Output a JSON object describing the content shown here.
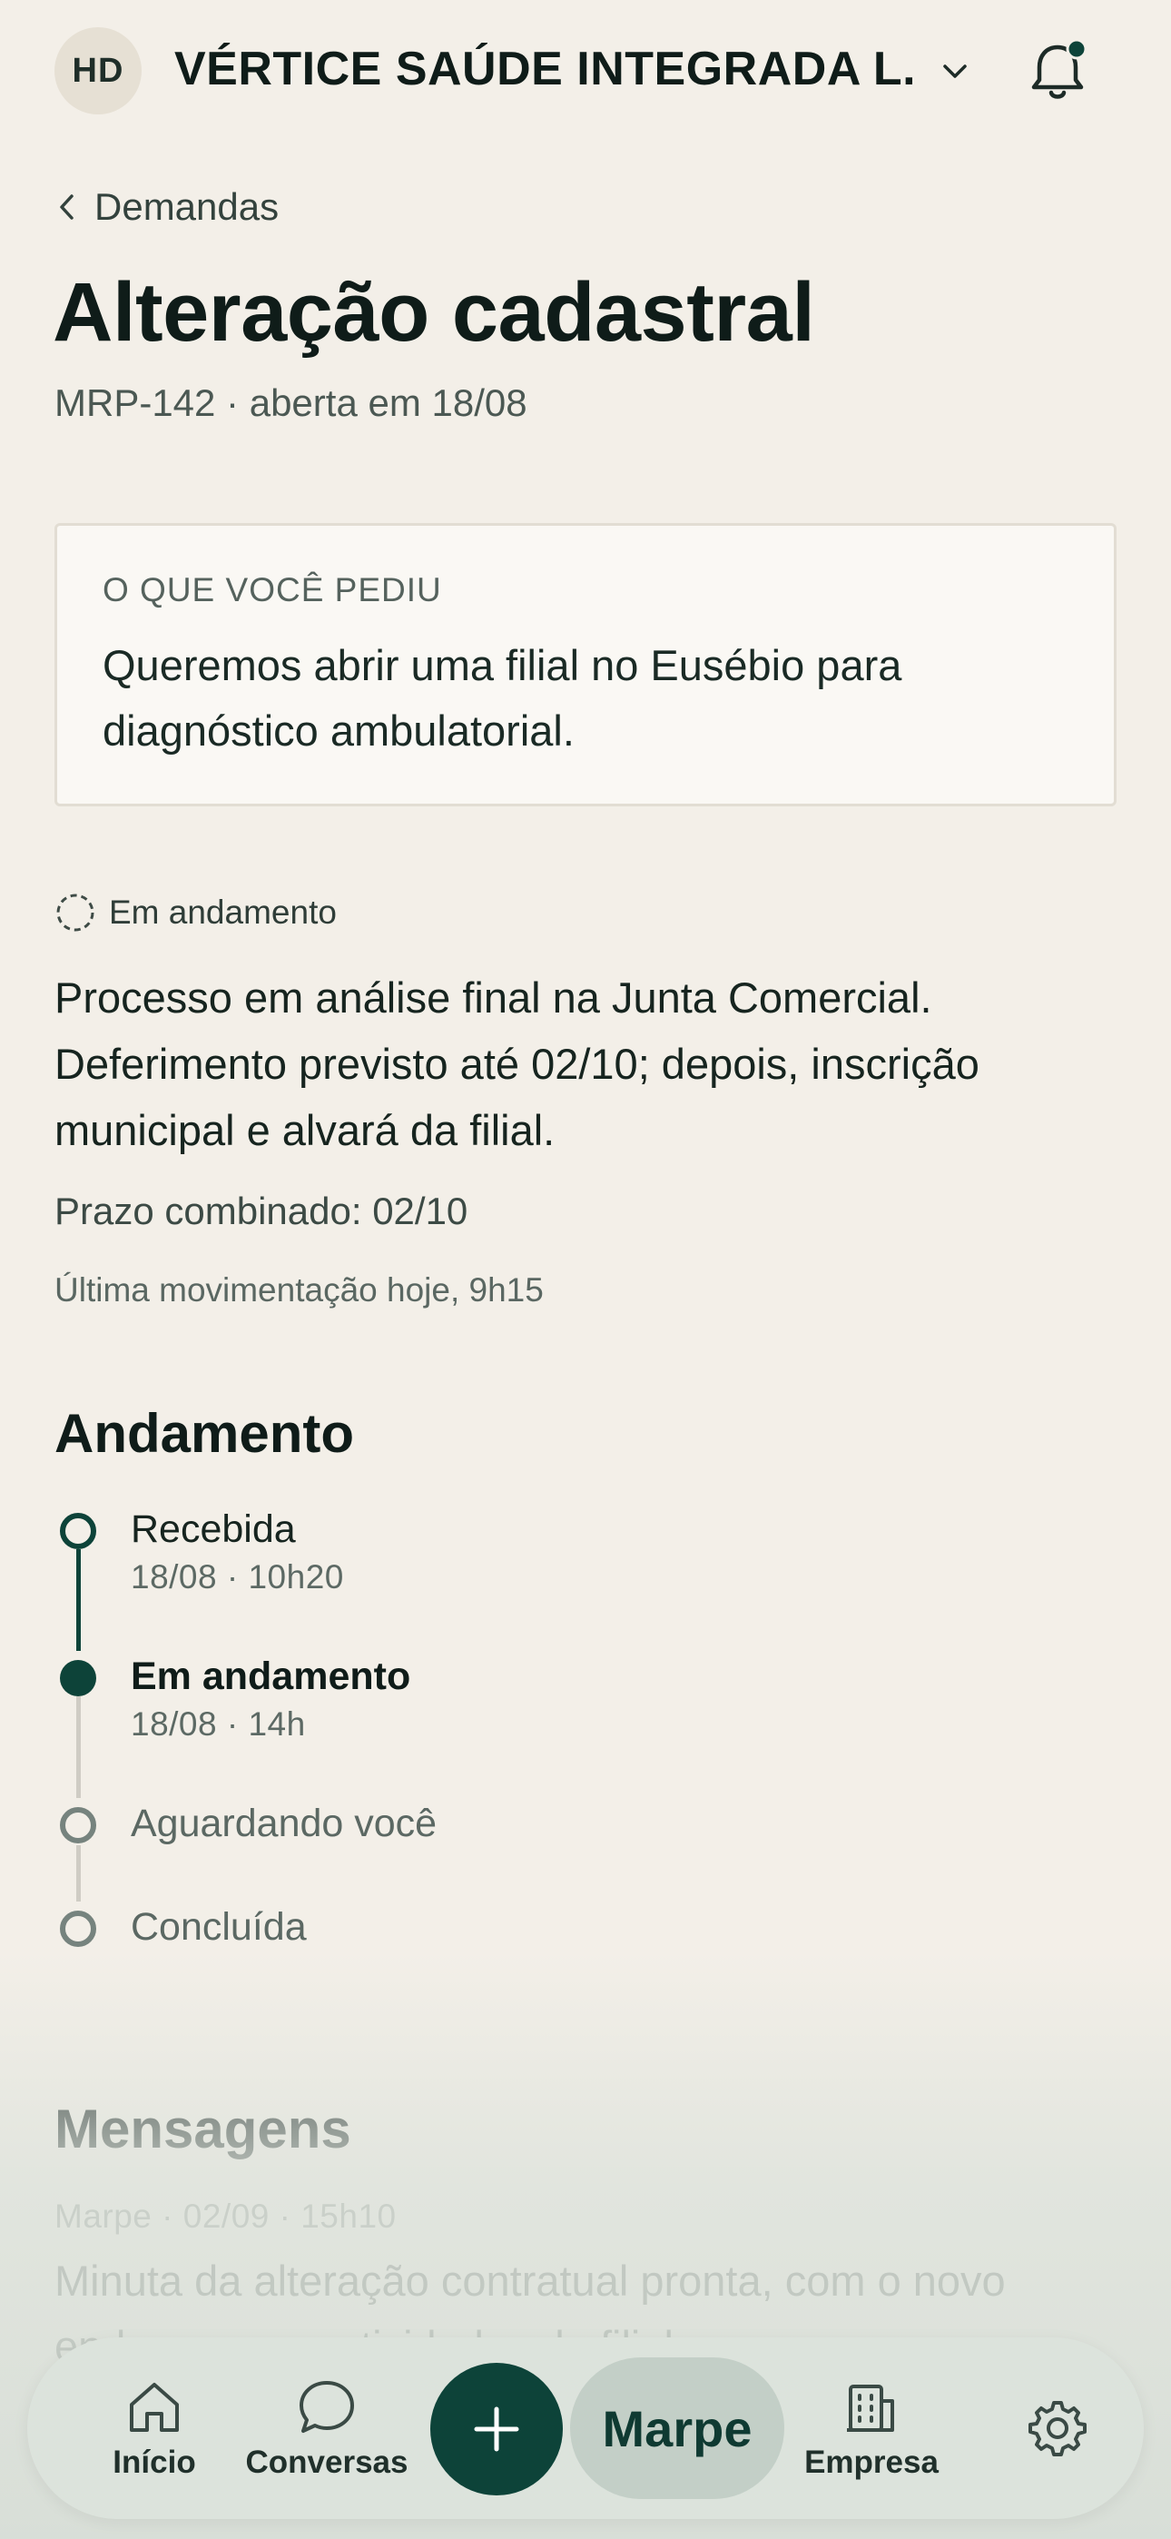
{
  "header": {
    "avatar_initials": "HD",
    "company_name": "VÉRTICE SAÚDE INTEGRADA L...",
    "switch_icon": "chevron-down-icon",
    "notification_icon": "bell-icon",
    "has_unread": true
  },
  "nav": {
    "back_label": "Demandas"
  },
  "demand": {
    "title": "Alteração cadastral",
    "subtitle": "MRP-142 · aberta em 18/08"
  },
  "request": {
    "kicker": "O QUE VOCÊ PEDIU",
    "text": "Queremos abrir uma filial no Eusébio para diagnóstico ambulatorial."
  },
  "status": {
    "label": "Em andamento",
    "description": "Processo em análise final na Junta Comercial. Deferimento previsto até 02/10; depois, inscrição municipal e alvará da filial.",
    "deadline": "Prazo combinado: 02/10",
    "last_update": "Última movimentação hoje, 9h15"
  },
  "timeline": {
    "title": "Andamento",
    "steps": [
      {
        "label": "Recebida",
        "time": "18/08 · 10h20",
        "state": "done"
      },
      {
        "label": "Em andamento",
        "time": "18/08 · 14h",
        "state": "current"
      },
      {
        "label": "Aguardando você",
        "time": "",
        "state": "pending"
      },
      {
        "label": "Concluída",
        "time": "",
        "state": "pending"
      }
    ]
  },
  "messages": {
    "title": "Mensagens",
    "items": [
      {
        "meta": "Marpe · 02/09 · 15h10",
        "text": "Minuta da alteração contratual pronta, com o novo endereço e as atividades da filial."
      }
    ]
  },
  "bottom_nav": {
    "home": "Início",
    "conversations": "Conversas",
    "add_icon": "plus-icon",
    "marpe": "Marpe",
    "company": "Empresa",
    "settings_icon": "gear-icon"
  },
  "colors": {
    "background": "#f3efe8",
    "primary": "#0d4339",
    "nav_bg": "#dce3dc"
  }
}
